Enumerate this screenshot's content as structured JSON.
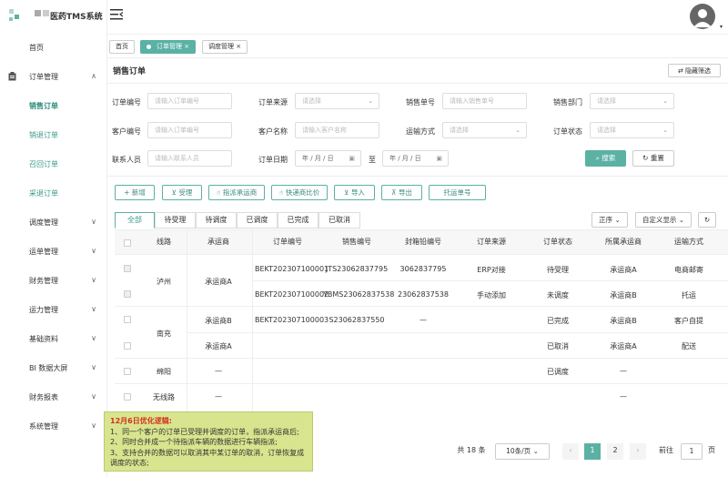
{
  "app": {
    "title": "医药TMS系统"
  },
  "menu": [
    {
      "label": "首页",
      "chevron": ""
    },
    {
      "label": "订单管理",
      "chevron": "∧"
    },
    {
      "label": "销售订单",
      "chevron": ""
    },
    {
      "label": "销退订单",
      "chevron": ""
    },
    {
      "label": "召回订单",
      "chevron": ""
    },
    {
      "label": "采退订单",
      "chevron": ""
    },
    {
      "label": "调度管理",
      "chevron": "∨"
    },
    {
      "label": "运单管理",
      "chevron": "∨"
    },
    {
      "label": "财务管理",
      "chevron": "∨"
    },
    {
      "label": "运力管理",
      "chevron": "∨"
    },
    {
      "label": "基础资料",
      "chevron": "∨"
    },
    {
      "label": "BI 数据大屏",
      "chevron": "∨"
    },
    {
      "label": "财务报表",
      "chevron": "∨"
    },
    {
      "label": "系统管理",
      "chevron": "∨"
    }
  ],
  "tabs": [
    {
      "label": "首页"
    },
    {
      "label": "订单管理",
      "close": "×"
    },
    {
      "label": "调度管理",
      "close": "×"
    }
  ],
  "page": {
    "title": "销售订单",
    "hide_filter": "隐藏筛选"
  },
  "filters": [
    {
      "label": "订单编号",
      "placeholder": "请输入订单编号"
    },
    {
      "label": "订单来源",
      "placeholder": "请选择"
    },
    {
      "label": "销售单号",
      "placeholder": "请输入销售单号"
    },
    {
      "label": "销售部门",
      "placeholder": "请选择"
    },
    {
      "label": "客户编号",
      "placeholder": "请输入订单编号"
    },
    {
      "label": "客户名称",
      "placeholder": "请输入客户名称"
    },
    {
      "label": "运输方式",
      "placeholder": "请选择"
    },
    {
      "label": "订单状态",
      "placeholder": "请选择"
    },
    {
      "label": "联系人员",
      "placeholder": "请输入联系人员"
    },
    {
      "label": "订单日期",
      "placeholder": ""
    }
  ],
  "date": {
    "from": "年 / 月 / 日",
    "to_label": "至",
    "to": "年 / 月 / 日"
  },
  "actions": {
    "search": "搜索",
    "reset": "重置"
  },
  "toolbar": [
    "新增",
    "受理",
    "指派承运商",
    "快递商比价",
    "导入",
    "导出",
    "托运单号"
  ],
  "status_tabs": [
    "全部",
    "待受理",
    "待调度",
    "已调度",
    "已完成",
    "已取消"
  ],
  "sort": {
    "order": "正序",
    "custom": "自定义显示"
  },
  "columns": [
    "线路",
    "承运商",
    "订单编号",
    "销售编号",
    "封箱铅编号",
    "订单来源",
    "订单状态",
    "所属承运商",
    "运输方式"
  ],
  "rows": [
    {
      "order": "BEKT202307100001",
      "sales": "JTS23062837795",
      "seal": "3062837795",
      "source": "ERP对接",
      "status": "待受理",
      "carrier": "承运商A",
      "mode": "电商邮寄"
    },
    {
      "order": "BEKT202307100002",
      "sales": "YBMS23062837538",
      "seal": "23062837538",
      "source": "手动添加",
      "status": "未调度",
      "carrier": "承运商B",
      "mode": "托运"
    },
    {
      "order": "BEKT202307100003",
      "sales": "S23062837550",
      "seal": "—",
      "source": "",
      "status": "已完成",
      "carrier": "承运商B",
      "mode": "客户自提"
    },
    {
      "order": "",
      "sales": "",
      "seal": "",
      "source": "",
      "status": "已取消",
      "carrier": "承运商A",
      "mode": "配送"
    },
    {
      "order": "",
      "sales": "",
      "seal": "",
      "source": "",
      "status": "已调度",
      "carrier": "—",
      "mode": ""
    },
    {
      "order": "",
      "sales": "",
      "seal": "",
      "source": "",
      "status": "",
      "carrier": "—",
      "mode": ""
    }
  ],
  "groups": [
    {
      "route": "泸州",
      "carrier": "承运商A"
    },
    {
      "route": "南充",
      "carrier": "承运商B"
    },
    {
      "route": "",
      "carrier": "承运商A"
    },
    {
      "route": "绵阳",
      "carrier": "—"
    },
    {
      "route": "无线路",
      "carrier": "—"
    }
  ],
  "note": {
    "title": "12月6日优化逻辑:",
    "lines": [
      "1、同一个客户的订单已受理并调度的订单，指派承运商后;",
      "2、同时合并成一个待指派车辆的数据进行车辆指派;",
      "3、支持合并的数据可以取消其中某订单的取消，订单恢复成调度的状态;"
    ]
  },
  "pagination": {
    "total": "共 18 条",
    "size": "10条/页",
    "p1": "1",
    "p2": "2",
    "goto": "前往",
    "page_input": "1",
    "page_unit": "页",
    "prev": "‹",
    "next": "›"
  }
}
